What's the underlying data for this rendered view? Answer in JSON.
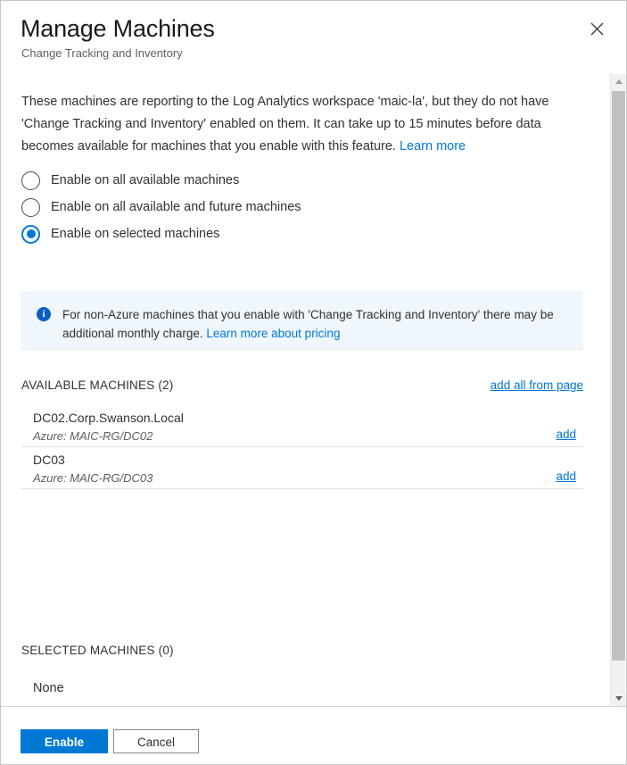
{
  "header": {
    "title": "Manage Machines",
    "subtitle": "Change Tracking and Inventory",
    "close_label": "×",
    "close_icon": "close-icon"
  },
  "intro": {
    "text": "These machines are reporting to the Log Analytics workspace 'maic-la', but they do not have 'Change Tracking and Inventory' enabled on them. It can take up to 15 minutes before data becomes available for machines that you enable with this feature. ",
    "link_label": "Learn more"
  },
  "options": {
    "items": [
      {
        "label": "Enable on all available machines",
        "selected": false
      },
      {
        "label": "Enable on all available and future machines",
        "selected": false
      },
      {
        "label": "Enable on selected machines",
        "selected": true
      }
    ]
  },
  "info_banner": {
    "icon": "info-icon",
    "text": "For non-Azure machines that you enable with 'Change Tracking and Inventory' there may be additional monthly charge. ",
    "link_label": "Learn more about pricing",
    "background": "#eff6fc",
    "icon_color": "#0b5fc2"
  },
  "available": {
    "section_title": "AVAILABLE MACHINES (2)",
    "action_label": "add all from page",
    "rows": [
      {
        "name": "DC02.Corp.Swanson.Local",
        "sub": "Azure: MAIC-RG/DC02",
        "action": "add"
      },
      {
        "name": "DC03",
        "sub": "Azure: MAIC-RG/DC03",
        "action": "add"
      }
    ]
  },
  "selected": {
    "section_title": "SELECTED MACHINES (0)",
    "empty_label": "None"
  },
  "scrollbar": {
    "up_label": "scroll up",
    "down_label": "scroll down"
  },
  "footer": {
    "primary_label": "Enable",
    "secondary_label": "Cancel",
    "primary_color": "#0078d4"
  }
}
